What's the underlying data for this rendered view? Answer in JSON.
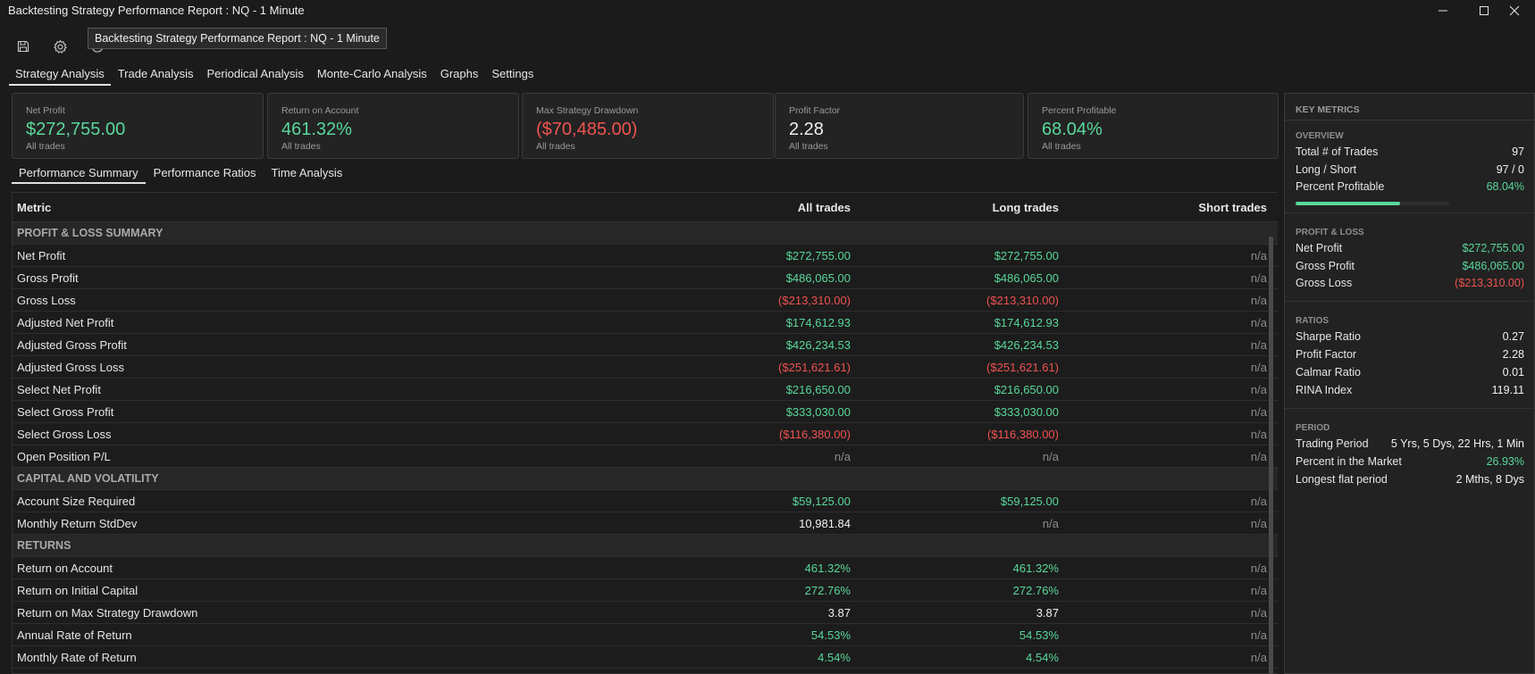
{
  "window": {
    "title": "Backtesting Strategy Performance Report : NQ - 1 Minute",
    "tooltip": "Backtesting Strategy Performance Report : NQ - 1 Minute"
  },
  "icons": {
    "save": "save-icon",
    "settings": "gear-icon",
    "info": "info-icon"
  },
  "main_tabs": [
    "Strategy Analysis",
    "Trade Analysis",
    "Periodical Analysis",
    "Monte-Carlo Analysis",
    "Graphs",
    "Settings"
  ],
  "cards": [
    {
      "label": "Net Profit",
      "value": "$272,755.00",
      "sub": "All trades",
      "tone": "pos"
    },
    {
      "label": "Return on Account",
      "value": "461.32%",
      "sub": "All trades",
      "tone": "pos"
    },
    {
      "label": "Max Strategy Drawdown",
      "value": "($70,485.00)",
      "sub": "All trades",
      "tone": "neg"
    },
    {
      "label": "Profit Factor",
      "value": "2.28",
      "sub": "All trades",
      "tone": "neu"
    },
    {
      "label": "Percent Profitable",
      "value": "68.04%",
      "sub": "All trades",
      "tone": "pos"
    }
  ],
  "sub_tabs": [
    "Performance Summary",
    "Performance Ratios",
    "Time Analysis"
  ],
  "table": {
    "headers": [
      "Metric",
      "All trades",
      "Long trades",
      "Short trades"
    ],
    "rows": [
      {
        "section": "PROFIT & LOSS SUMMARY"
      },
      {
        "metric": "Net Profit",
        "all": "$272,755.00",
        "long": "$272,755.00",
        "short": "n/a",
        "all_tone": "pos",
        "long_tone": "pos"
      },
      {
        "metric": "Gross Profit",
        "all": "$486,065.00",
        "long": "$486,065.00",
        "short": "n/a",
        "all_tone": "pos",
        "long_tone": "pos"
      },
      {
        "metric": "Gross Loss",
        "all": "($213,310.00)",
        "long": "($213,310.00)",
        "short": "n/a",
        "all_tone": "neg",
        "long_tone": "neg"
      },
      {
        "metric": "Adjusted Net Profit",
        "all": "$174,612.93",
        "long": "$174,612.93",
        "short": "n/a",
        "all_tone": "pos",
        "long_tone": "pos"
      },
      {
        "metric": "Adjusted Gross Profit",
        "all": "$426,234.53",
        "long": "$426,234.53",
        "short": "n/a",
        "all_tone": "pos",
        "long_tone": "pos"
      },
      {
        "metric": "Adjusted Gross Loss",
        "all": "($251,621.61)",
        "long": "($251,621.61)",
        "short": "n/a",
        "all_tone": "neg",
        "long_tone": "neg"
      },
      {
        "metric": "Select Net Profit",
        "all": "$216,650.00",
        "long": "$216,650.00",
        "short": "n/a",
        "all_tone": "pos",
        "long_tone": "pos"
      },
      {
        "metric": "Select Gross Profit",
        "all": "$333,030.00",
        "long": "$333,030.00",
        "short": "n/a",
        "all_tone": "pos",
        "long_tone": "pos"
      },
      {
        "metric": "Select Gross Loss",
        "all": "($116,380.00)",
        "long": "($116,380.00)",
        "short": "n/a",
        "all_tone": "neg",
        "long_tone": "neg"
      },
      {
        "metric": "Open Position P/L",
        "all": "n/a",
        "long": "n/a",
        "short": "n/a",
        "all_tone": "na",
        "long_tone": "na"
      },
      {
        "section": "CAPITAL AND VOLATILITY"
      },
      {
        "metric": "Account Size Required",
        "all": "$59,125.00",
        "long": "$59,125.00",
        "short": "n/a",
        "all_tone": "pos",
        "long_tone": "pos"
      },
      {
        "metric": "Monthly Return StdDev",
        "all": "10,981.84",
        "long": "n/a",
        "short": "n/a",
        "all_tone": "neu",
        "long_tone": "na"
      },
      {
        "section": "RETURNS"
      },
      {
        "metric": "Return on Account",
        "all": "461.32%",
        "long": "461.32%",
        "short": "n/a",
        "all_tone": "pos",
        "long_tone": "pos"
      },
      {
        "metric": "Return on Initial Capital",
        "all": "272.76%",
        "long": "272.76%",
        "short": "n/a",
        "all_tone": "pos",
        "long_tone": "pos"
      },
      {
        "metric": "Return on Max Strategy Drawdown",
        "all": "3.87",
        "long": "3.87",
        "short": "n/a",
        "all_tone": "neu",
        "long_tone": "neu"
      },
      {
        "metric": "Annual Rate of Return",
        "all": "54.53%",
        "long": "54.53%",
        "short": "n/a",
        "all_tone": "pos",
        "long_tone": "pos"
      },
      {
        "metric": "Monthly Rate of Return",
        "all": "4.54%",
        "long": "4.54%",
        "short": "n/a",
        "all_tone": "pos",
        "long_tone": "pos"
      }
    ]
  },
  "key_metrics": {
    "title": "KEY METRICS",
    "overview": {
      "title": "OVERVIEW",
      "total_trades_label": "Total # of Trades",
      "total_trades": "97",
      "long_short_label": "Long / Short",
      "long_short": "97 / 0",
      "percent_profitable_label": "Percent Profitable",
      "percent_profitable": "68.04%",
      "percent_profitable_fraction": 0.6804
    },
    "pl": {
      "title": "PROFIT & LOSS",
      "net_label": "Net Profit",
      "net": "$272,755.00",
      "gross_profit_label": "Gross Profit",
      "gross_profit": "$486,065.00",
      "gross_loss_label": "Gross Loss",
      "gross_loss": "($213,310.00)"
    },
    "ratios": {
      "title": "RATIOS",
      "sharpe_label": "Sharpe Ratio",
      "sharpe": "0.27",
      "profit_factor_label": "Profit Factor",
      "profit_factor": "2.28",
      "calmar_label": "Calmar Ratio",
      "calmar": "0.01",
      "rina_label": "RINA Index",
      "rina": "119.11"
    },
    "period": {
      "title": "PERIOD",
      "trading_label": "Trading Period",
      "trading": "5 Yrs, 5 Dys, 22 Hrs, 1 Min",
      "in_market_label": "Percent in the Market",
      "in_market": "26.93%",
      "flat_label": "Longest flat period",
      "flat": "2 Mths, 8 Dys"
    }
  },
  "colors": {
    "positive": "#59d89a",
    "negative": "#ef5350",
    "background": "#1b1b1b"
  }
}
